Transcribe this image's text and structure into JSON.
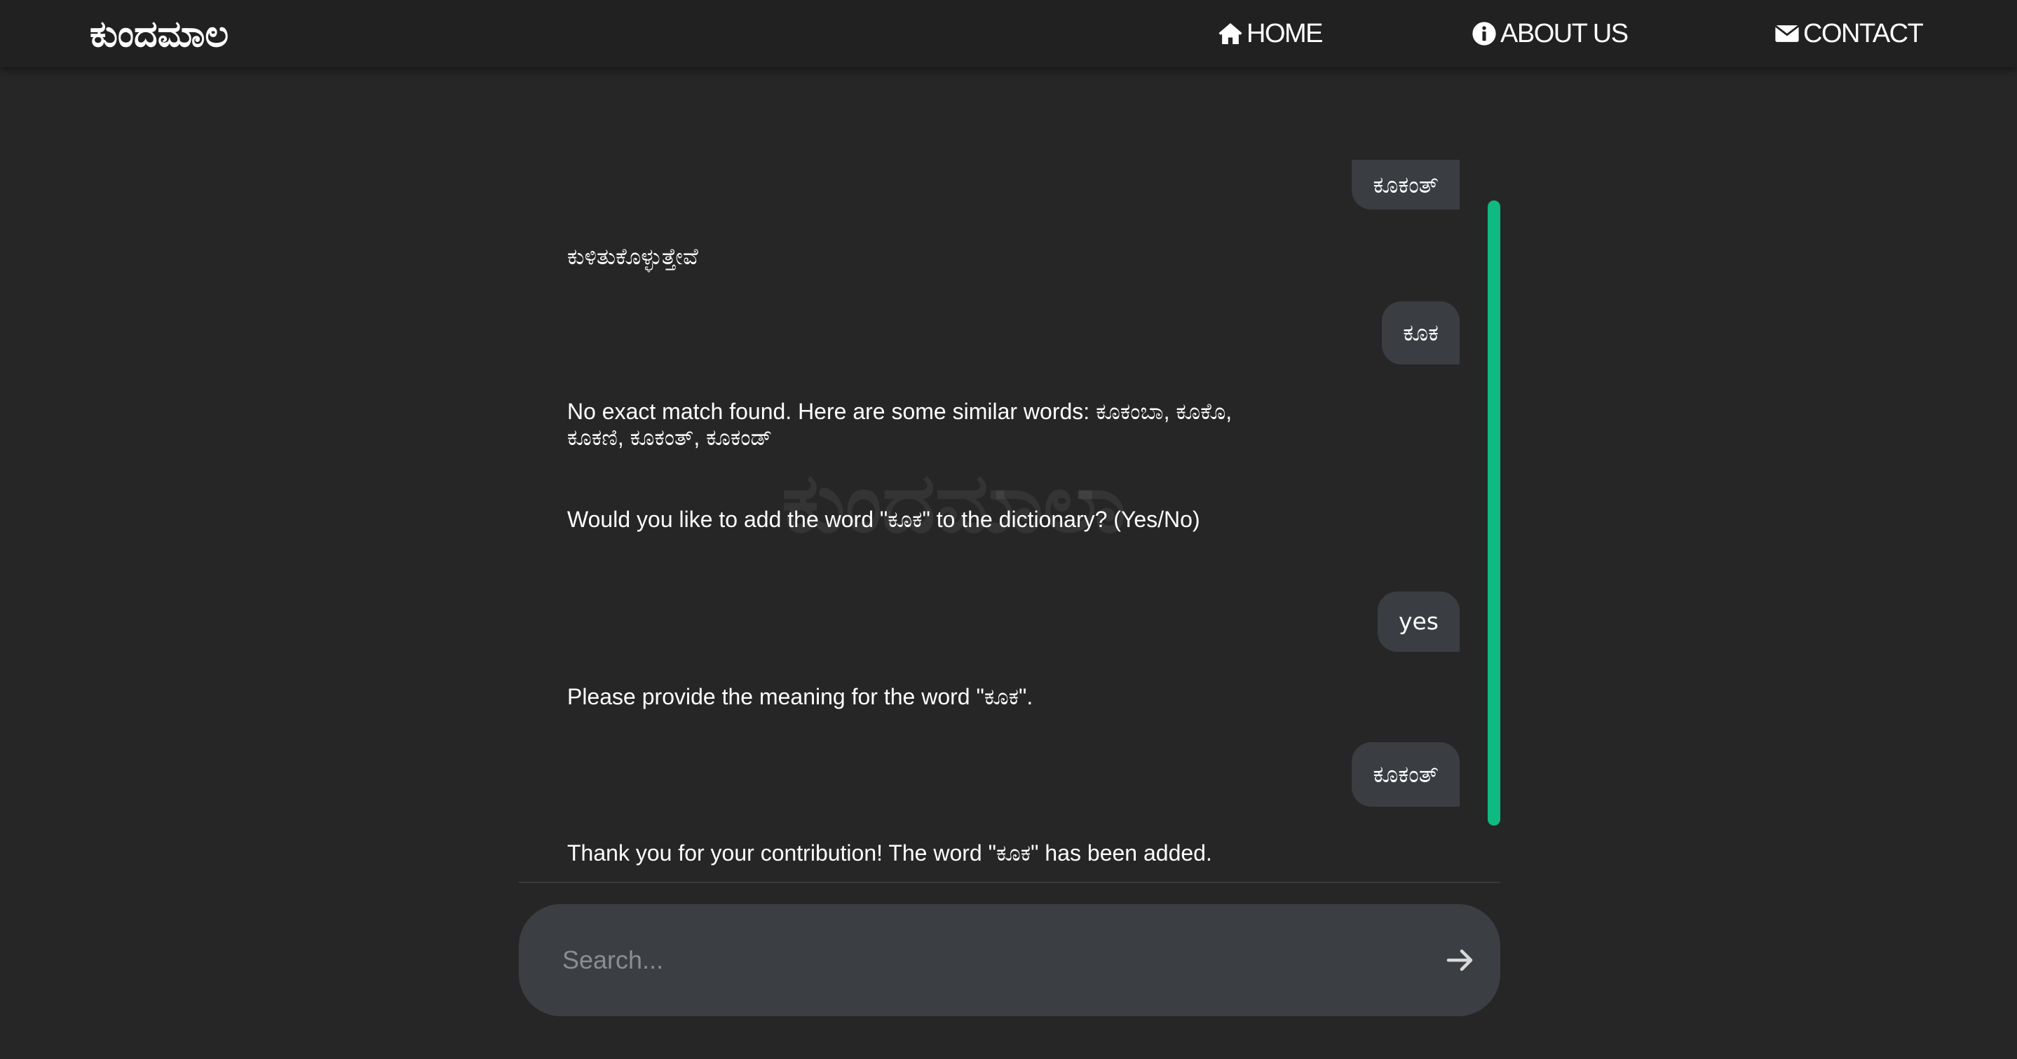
{
  "brand": {
    "title": "ಕುಂದಮಾಲ"
  },
  "nav": {
    "home_label": "HOME",
    "about_label": "ABOUT US",
    "contact_label": "CONTACT"
  },
  "watermark": "ಕುಂದಮಾಲಾ",
  "messages": [
    {
      "sender": "user",
      "text": "ಕೂಕಂತ್"
    },
    {
      "sender": "bot",
      "text": "ಕುಳಿತುಕೊಳ್ಳುತ್ತೇವೆ"
    },
    {
      "sender": "user",
      "text": "ಕೂಕ"
    },
    {
      "sender": "bot",
      "text": "No exact match found. Here are some similar words: ಕೂಕಂಬಾ, ಕೂಕೊ, ಕೂಕಣಿ, ಕೂಕಂತ್, ಕೂಕಂಡ್"
    },
    {
      "sender": "bot",
      "text": "Would you like to add the word \"ಕೂಕ\" to the dictionary? (Yes/No)"
    },
    {
      "sender": "user",
      "text": "yes"
    },
    {
      "sender": "bot",
      "text": "Please provide the meaning for the word \"ಕೂಕ\"."
    },
    {
      "sender": "user",
      "text": "ಕೂಕಂತ್"
    },
    {
      "sender": "bot",
      "text": "Thank you for your contribution! The word \"ಕೂಕ\" has been added."
    }
  ],
  "search": {
    "placeholder": "Search...",
    "value": ""
  },
  "icons": {
    "home": "home-icon",
    "about": "info-circle-icon",
    "contact": "envelope-icon",
    "send": "arrow-right-icon"
  },
  "colors": {
    "background": "#262626",
    "navbar": "#212121",
    "user_bubble": "#3a3d42",
    "search_bar": "#3b3e43",
    "scrollbar": "#10b981"
  }
}
